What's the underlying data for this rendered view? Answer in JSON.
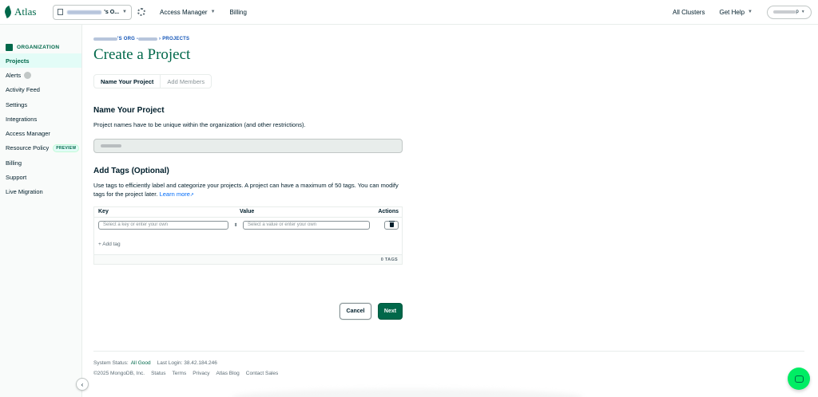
{
  "topbar": {
    "logo_text": "Atlas",
    "org_name": "'s O...",
    "access_manager": "Access Manager",
    "billing": "Billing",
    "all_clusters": "All Clusters",
    "get_help": "Get Help",
    "user_name": "p"
  },
  "sidebar": {
    "heading": "ORGANIZATION",
    "items": [
      {
        "label": "Projects",
        "active": true
      },
      {
        "label": "Alerts"
      },
      {
        "label": "Activity Feed"
      },
      {
        "label": "Settings"
      },
      {
        "label": "Integrations"
      },
      {
        "label": "Access Manager"
      },
      {
        "label": "Resource Policy",
        "badge": "PREVIEW"
      },
      {
        "label": "Billing"
      },
      {
        "label": "Support"
      },
      {
        "label": "Live Migration"
      }
    ]
  },
  "main": {
    "breadcrumb": {
      "org": "'S ORG - ",
      "projects": "PROJECTS"
    },
    "title": "Create a Project",
    "steps": [
      "Name Your Project",
      "Add Members"
    ],
    "name_section": {
      "title": "Name Your Project",
      "description": "Project names have to be unique within the organization (and other restrictions)."
    },
    "tags_section": {
      "title": "Add Tags (Optional)",
      "description": "Use tags to efficiently label and categorize your projects. A project can have a maximum of 50 tags. You can modify tags for the project later.",
      "learn_more": "Learn more",
      "columns": {
        "key": "Key",
        "value": "Value",
        "actions": "Actions"
      },
      "key_placeholder": "Select a key or enter your own",
      "value_placeholder": "Select a value or enter your own",
      "add_tag": "+ Add tag",
      "count": "0 TAGS"
    },
    "buttons": {
      "cancel": "Cancel",
      "next": "Next"
    }
  },
  "footer": {
    "status_label": "System Status:",
    "status_value": "All Good",
    "last_login": "Last Login: 38.42.184.246",
    "copyright": "©2025 MongoDB, Inc.",
    "links": [
      "Status",
      "Terms",
      "Privacy",
      "Atlas Blog",
      "Contact Sales"
    ]
  },
  "colors": {
    "brand_green": "#00684a",
    "accent_green": "#00ed64",
    "link_blue": "#016bf8",
    "breadcrumb_blue": "#1254b7"
  }
}
